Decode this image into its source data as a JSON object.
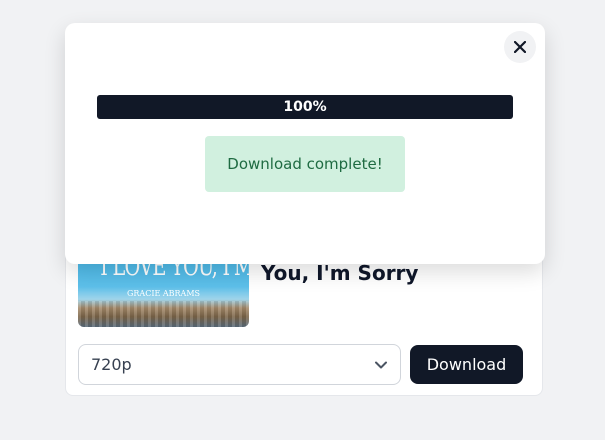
{
  "modal": {
    "progress": {
      "percent": 100,
      "label": "100%"
    },
    "status_message": "Download complete!",
    "close_icon": "close-icon"
  },
  "card": {
    "track_title": "You, I'm Sorry",
    "thumbnail": {
      "title_text": "I LOVE YOU, I'M SORRY",
      "artist_text": "GRACIE ABRAMS"
    },
    "quality_select": {
      "value": "720p",
      "icon": "chevron-down-icon"
    },
    "download_label": "Download"
  },
  "colors": {
    "page_bg": "#f1f2f4",
    "primary": "#111827",
    "success_bg": "#d1f0df",
    "success_text": "#1f6b42"
  }
}
